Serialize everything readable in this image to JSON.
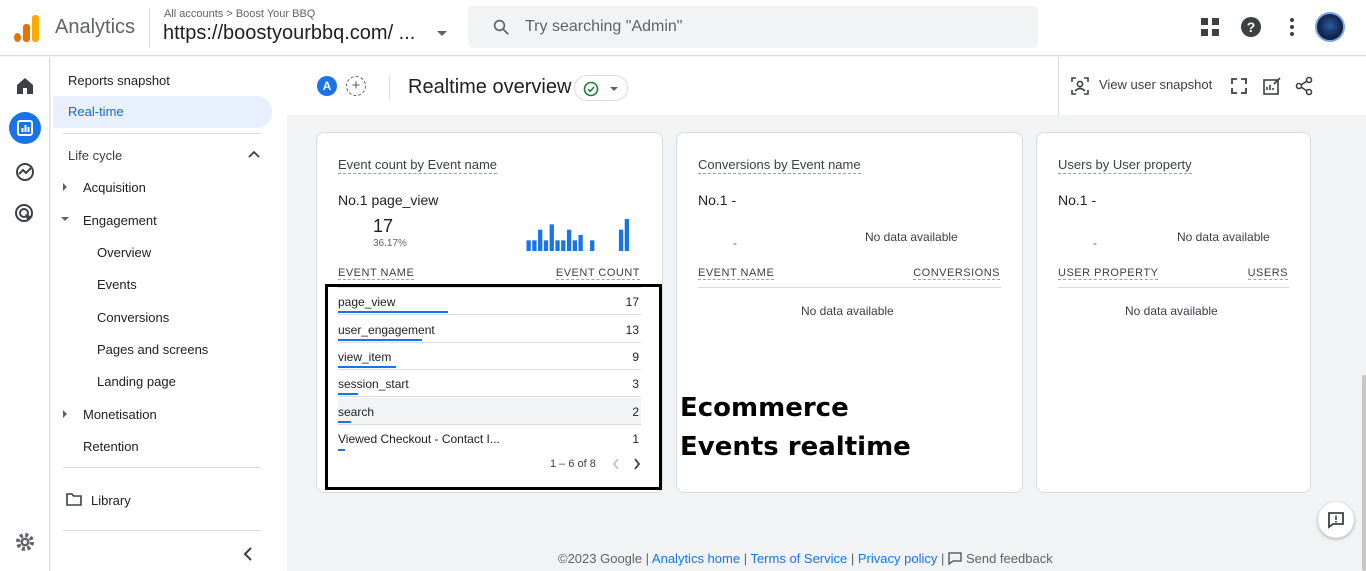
{
  "app": {
    "name": "Analytics"
  },
  "account": {
    "breadcrumb": "All accounts > Boost Your BBQ",
    "property": "https://boostyourbbq.com/ ..."
  },
  "search": {
    "placeholder": "Try searching \"Admin\""
  },
  "nav": {
    "reports_snapshot": "Reports snapshot",
    "realtime": "Real-time",
    "section": "Life cycle",
    "acquisition": "Acquisition",
    "engagement": "Engagement",
    "engagement_items": [
      "Overview",
      "Events",
      "Conversions",
      "Pages and screens",
      "Landing page"
    ],
    "monetisation": "Monetisation",
    "retention": "Retention",
    "library": "Library"
  },
  "header": {
    "comparison_chip": "A",
    "title": "Realtime overview",
    "view_snapshot": "View user snapshot"
  },
  "card_events": {
    "title_a": "Event count by ",
    "title_b": "Event name",
    "top_label": "No.1  page_view",
    "top_value": "17",
    "top_pct": "36.17%",
    "spark_values": [
      2,
      2,
      4,
      2,
      5,
      2,
      2,
      4,
      2,
      3,
      0,
      2,
      0,
      0,
      0,
      0,
      4,
      6
    ],
    "col_name": "EVENT NAME",
    "col_count": "EVENT COUNT",
    "rows": [
      {
        "name": "page_view",
        "count": "17",
        "share": 1.0
      },
      {
        "name": "user_engagement",
        "count": "13",
        "share": 0.765
      },
      {
        "name": "view_item",
        "count": "9",
        "share": 0.53
      },
      {
        "name": "session_start",
        "count": "3",
        "share": 0.18
      },
      {
        "name": "search",
        "count": "2",
        "share": 0.12
      },
      {
        "name": "Viewed Checkout - Contact I...",
        "count": "1",
        "share": 0.06
      }
    ],
    "pager": "1 – 6 of 8"
  },
  "card_conversions": {
    "title_a": "Conversions by ",
    "title_b": "Event name",
    "top_label": "No.1  -",
    "top_value": "-",
    "no_data_top": "No data available",
    "col_name": "EVENT NAME",
    "col_value": "CONVERSIONS",
    "no_data_table": "No data available"
  },
  "card_users": {
    "title_a": "Users by ",
    "title_b": "User property",
    "top_label": "No.1  -",
    "top_value": "-",
    "no_data_top": "No data available",
    "col_name": "USER PROPERTY",
    "col_value": "USERS",
    "no_data_table": "No data available"
  },
  "annotation": {
    "line1": "Ecommerce",
    "line2": "Events realtime"
  },
  "footer": {
    "copyright": "©2023 Google",
    "sep": " | ",
    "home": "Analytics home",
    "terms": "Terms of Service",
    "privacy": "Privacy policy",
    "feedback": "Send feedback"
  },
  "colors": {
    "accent": "#1a73e8",
    "logo_orange": "#e37400",
    "logo_yellow": "#f9ab00",
    "success": "#188038"
  }
}
